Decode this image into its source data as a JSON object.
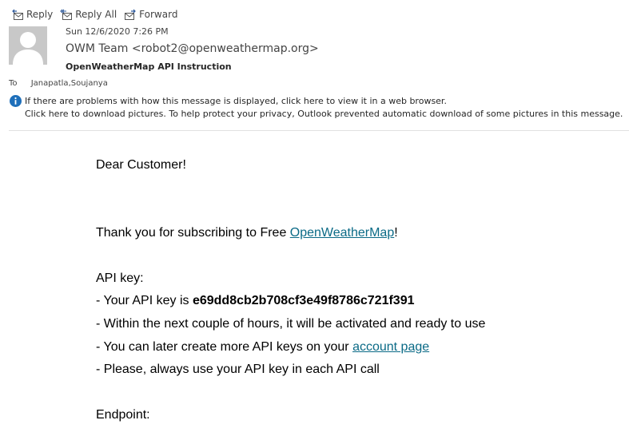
{
  "toolbar": {
    "reply_label": "Reply",
    "reply_all_label": "Reply All",
    "forward_label": "Forward"
  },
  "header": {
    "date": "Sun 12/6/2020 7:26 PM",
    "from": "OWM Team <robot2@openweathermap.org>",
    "subject": "OpenWeatherMap API Instruction",
    "to_label": "To",
    "to_value": "Janapatla,Soujanya"
  },
  "info_bar": {
    "line1": "If there are problems with how this message is displayed, click here to view it in a web browser.",
    "line2": "Click here to download pictures. To help protect your privacy, Outlook prevented automatic download of some pictures in this message."
  },
  "message": {
    "greeting": "Dear Customer!",
    "thanks_prefix": "Thank you for subscribing to Free ",
    "thanks_link": "OpenWeatherMap",
    "thanks_suffix": "!",
    "api_heading": "API key:",
    "key_prefix": "- Your API key is ",
    "api_key": "e69dd8cb2b708cf3e49f8786c721f391",
    "activation": "- Within the next couple of hours, it will be activated and ready to use",
    "more_keys_prefix": "- You can later create more API keys on your ",
    "account_link": "account page",
    "always_use": "- Please, always use your API key in each API call",
    "endpoint_heading": "Endpoint:"
  },
  "colors": {
    "link": "#0a6a86",
    "info_icon": "#1e6fba",
    "avatar_bg": "#c8c8c8"
  }
}
